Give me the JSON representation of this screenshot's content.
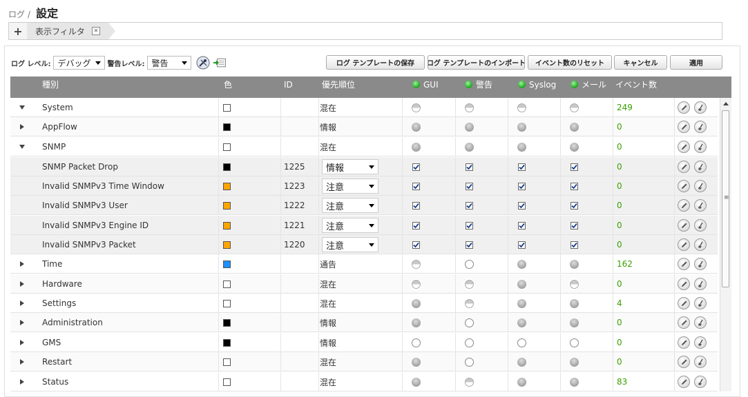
{
  "breadcrumb": {
    "parent": "ログ",
    "separator": "/",
    "title": "設定"
  },
  "filter_bar": {
    "add_label": "+",
    "tab_label": "表示フィルタ",
    "tab_close": "✕"
  },
  "toolbar": {
    "log_level_label": "ログ レベル:",
    "log_level_value": "デバッグ",
    "alert_level_label": "警告レベル:",
    "alert_level_value": "警告",
    "buttons": {
      "save_template": "ログ テンプレートの保存",
      "import_template": "ログ テンプレートのインポート",
      "reset_events": "イベント数のリセット",
      "cancel": "キャンセル",
      "apply": "適用"
    }
  },
  "table": {
    "headers": {
      "category": "種別",
      "color": "色",
      "id": "ID",
      "priority": "優先順位",
      "gui": "GUI",
      "alert": "警告",
      "syslog": "Syslog",
      "mail": "メール",
      "events": "イベント数"
    },
    "rows": [
      {
        "name": "System",
        "expander": "down",
        "color": "#ffffff",
        "id": "",
        "priority": "混在",
        "ind": [
          "half",
          "half",
          "half",
          "half"
        ],
        "count": "249"
      },
      {
        "name": "AppFlow",
        "expander": "right",
        "color": "#000000",
        "id": "",
        "priority": "情報",
        "ind": [
          "gray",
          "gray",
          "gray",
          "gray"
        ],
        "count": "0"
      },
      {
        "name": "SNMP",
        "expander": "down",
        "color": "#ffffff",
        "id": "",
        "priority": "混在",
        "ind": [
          "gray",
          "gray",
          "gray",
          "gray"
        ],
        "count": "0"
      },
      {
        "name": "SNMP Packet Drop",
        "child": true,
        "color": "#000000",
        "id": "1225",
        "priority": "情報",
        "ind": [
          "check",
          "check",
          "check",
          "check"
        ],
        "count": "0"
      },
      {
        "name": "Invalid SNMPv3 Time Window",
        "child": true,
        "color": "#ffa500",
        "id": "1223",
        "priority": "注意",
        "ind": [
          "check",
          "check",
          "check",
          "check"
        ],
        "count": "0"
      },
      {
        "name": "Invalid SNMPv3 User",
        "child": true,
        "color": "#ffa500",
        "id": "1222",
        "priority": "注意",
        "ind": [
          "check",
          "check",
          "check",
          "check"
        ],
        "count": "0"
      },
      {
        "name": "Invalid SNMPv3 Engine ID",
        "child": true,
        "color": "#ffa500",
        "id": "1221",
        "priority": "注意",
        "ind": [
          "check",
          "check",
          "check",
          "check"
        ],
        "count": "0"
      },
      {
        "name": "Invalid SNMPv3 Packet",
        "child": true,
        "color": "#ffa500",
        "id": "1220",
        "priority": "注意",
        "ind": [
          "check",
          "check",
          "check",
          "check"
        ],
        "count": "0"
      },
      {
        "name": "Time",
        "expander": "right",
        "color": "#1e90ff",
        "id": "",
        "priority": "通告",
        "ind": [
          "half",
          "empty",
          "gray",
          "gray"
        ],
        "count": "162"
      },
      {
        "name": "Hardware",
        "expander": "right",
        "color": "#ffffff",
        "id": "",
        "priority": "混在",
        "ind": [
          "half",
          "half",
          "gray",
          "half"
        ],
        "count": "0"
      },
      {
        "name": "Settings",
        "expander": "right",
        "color": "#ffffff",
        "id": "",
        "priority": "混在",
        "ind": [
          "gray",
          "half",
          "gray",
          "gray"
        ],
        "count": "4"
      },
      {
        "name": "Administration",
        "expander": "right",
        "color": "#000000",
        "id": "",
        "priority": "情報",
        "ind": [
          "gray",
          "empty",
          "gray",
          "gray"
        ],
        "count": "0"
      },
      {
        "name": "GMS",
        "expander": "right",
        "color": "#000000",
        "id": "",
        "priority": "情報",
        "ind": [
          "empty",
          "empty",
          "empty",
          "empty"
        ],
        "count": "0"
      },
      {
        "name": "Restart",
        "expander": "right",
        "color": "#ffffff",
        "id": "",
        "priority": "混在",
        "ind": [
          "gray",
          "empty",
          "gray",
          "gray"
        ],
        "count": "0"
      },
      {
        "name": "Status",
        "expander": "right",
        "color": "#ffffff",
        "id": "",
        "priority": "混在",
        "ind": [
          "gray",
          "half",
          "gray",
          "gray"
        ],
        "count": "83"
      }
    ]
  },
  "icons": {
    "row_edit": "pencil-icon",
    "row_clear": "broom-icon",
    "toolbar": [
      "tools-icon",
      "export-icon"
    ]
  },
  "colors": {
    "header_bg": "#8a8a8a",
    "count_green": "#39a000",
    "active_green": "#1aa51a"
  }
}
